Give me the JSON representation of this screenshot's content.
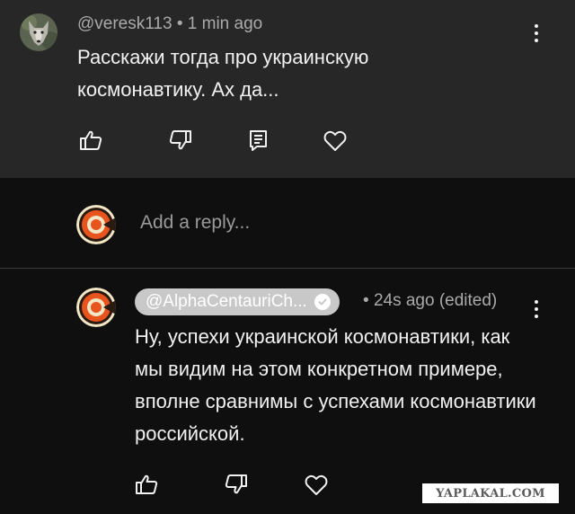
{
  "top_comment": {
    "author": "@veresk113",
    "separator": "•",
    "time": "1 min ago",
    "text": "Расскажи тогда про украинскую космонавтику. Ах да...",
    "actions": [
      "like-icon",
      "dislike-icon",
      "reply-icon",
      "heart-icon"
    ]
  },
  "reply_box": {
    "placeholder": "Add a reply..."
  },
  "reply_comment": {
    "author": "@AlphaCentauriCh...",
    "verified_icon": "check-circle-icon",
    "separator": "•",
    "time": "24s ago (edited)",
    "text": "Ну, успехи украинской космонавтики, как мы видим на этом конкретном примере, вполне сравнимы с успехами космонавтики российской.",
    "actions": [
      "like-icon",
      "dislike-icon",
      "heart-icon"
    ]
  },
  "colors": {
    "background": "#0f0f0f",
    "top_comment_bg": "#272727",
    "text": "#f1f1f1",
    "muted_text": "#aaaaaa",
    "chip_bg": "#c8c8c8",
    "logo_orange": "#e8541d",
    "logo_cream": "#f1e6c6",
    "logo_dark": "#2a1b12"
  },
  "watermark": "YAPLAKAL.COM"
}
